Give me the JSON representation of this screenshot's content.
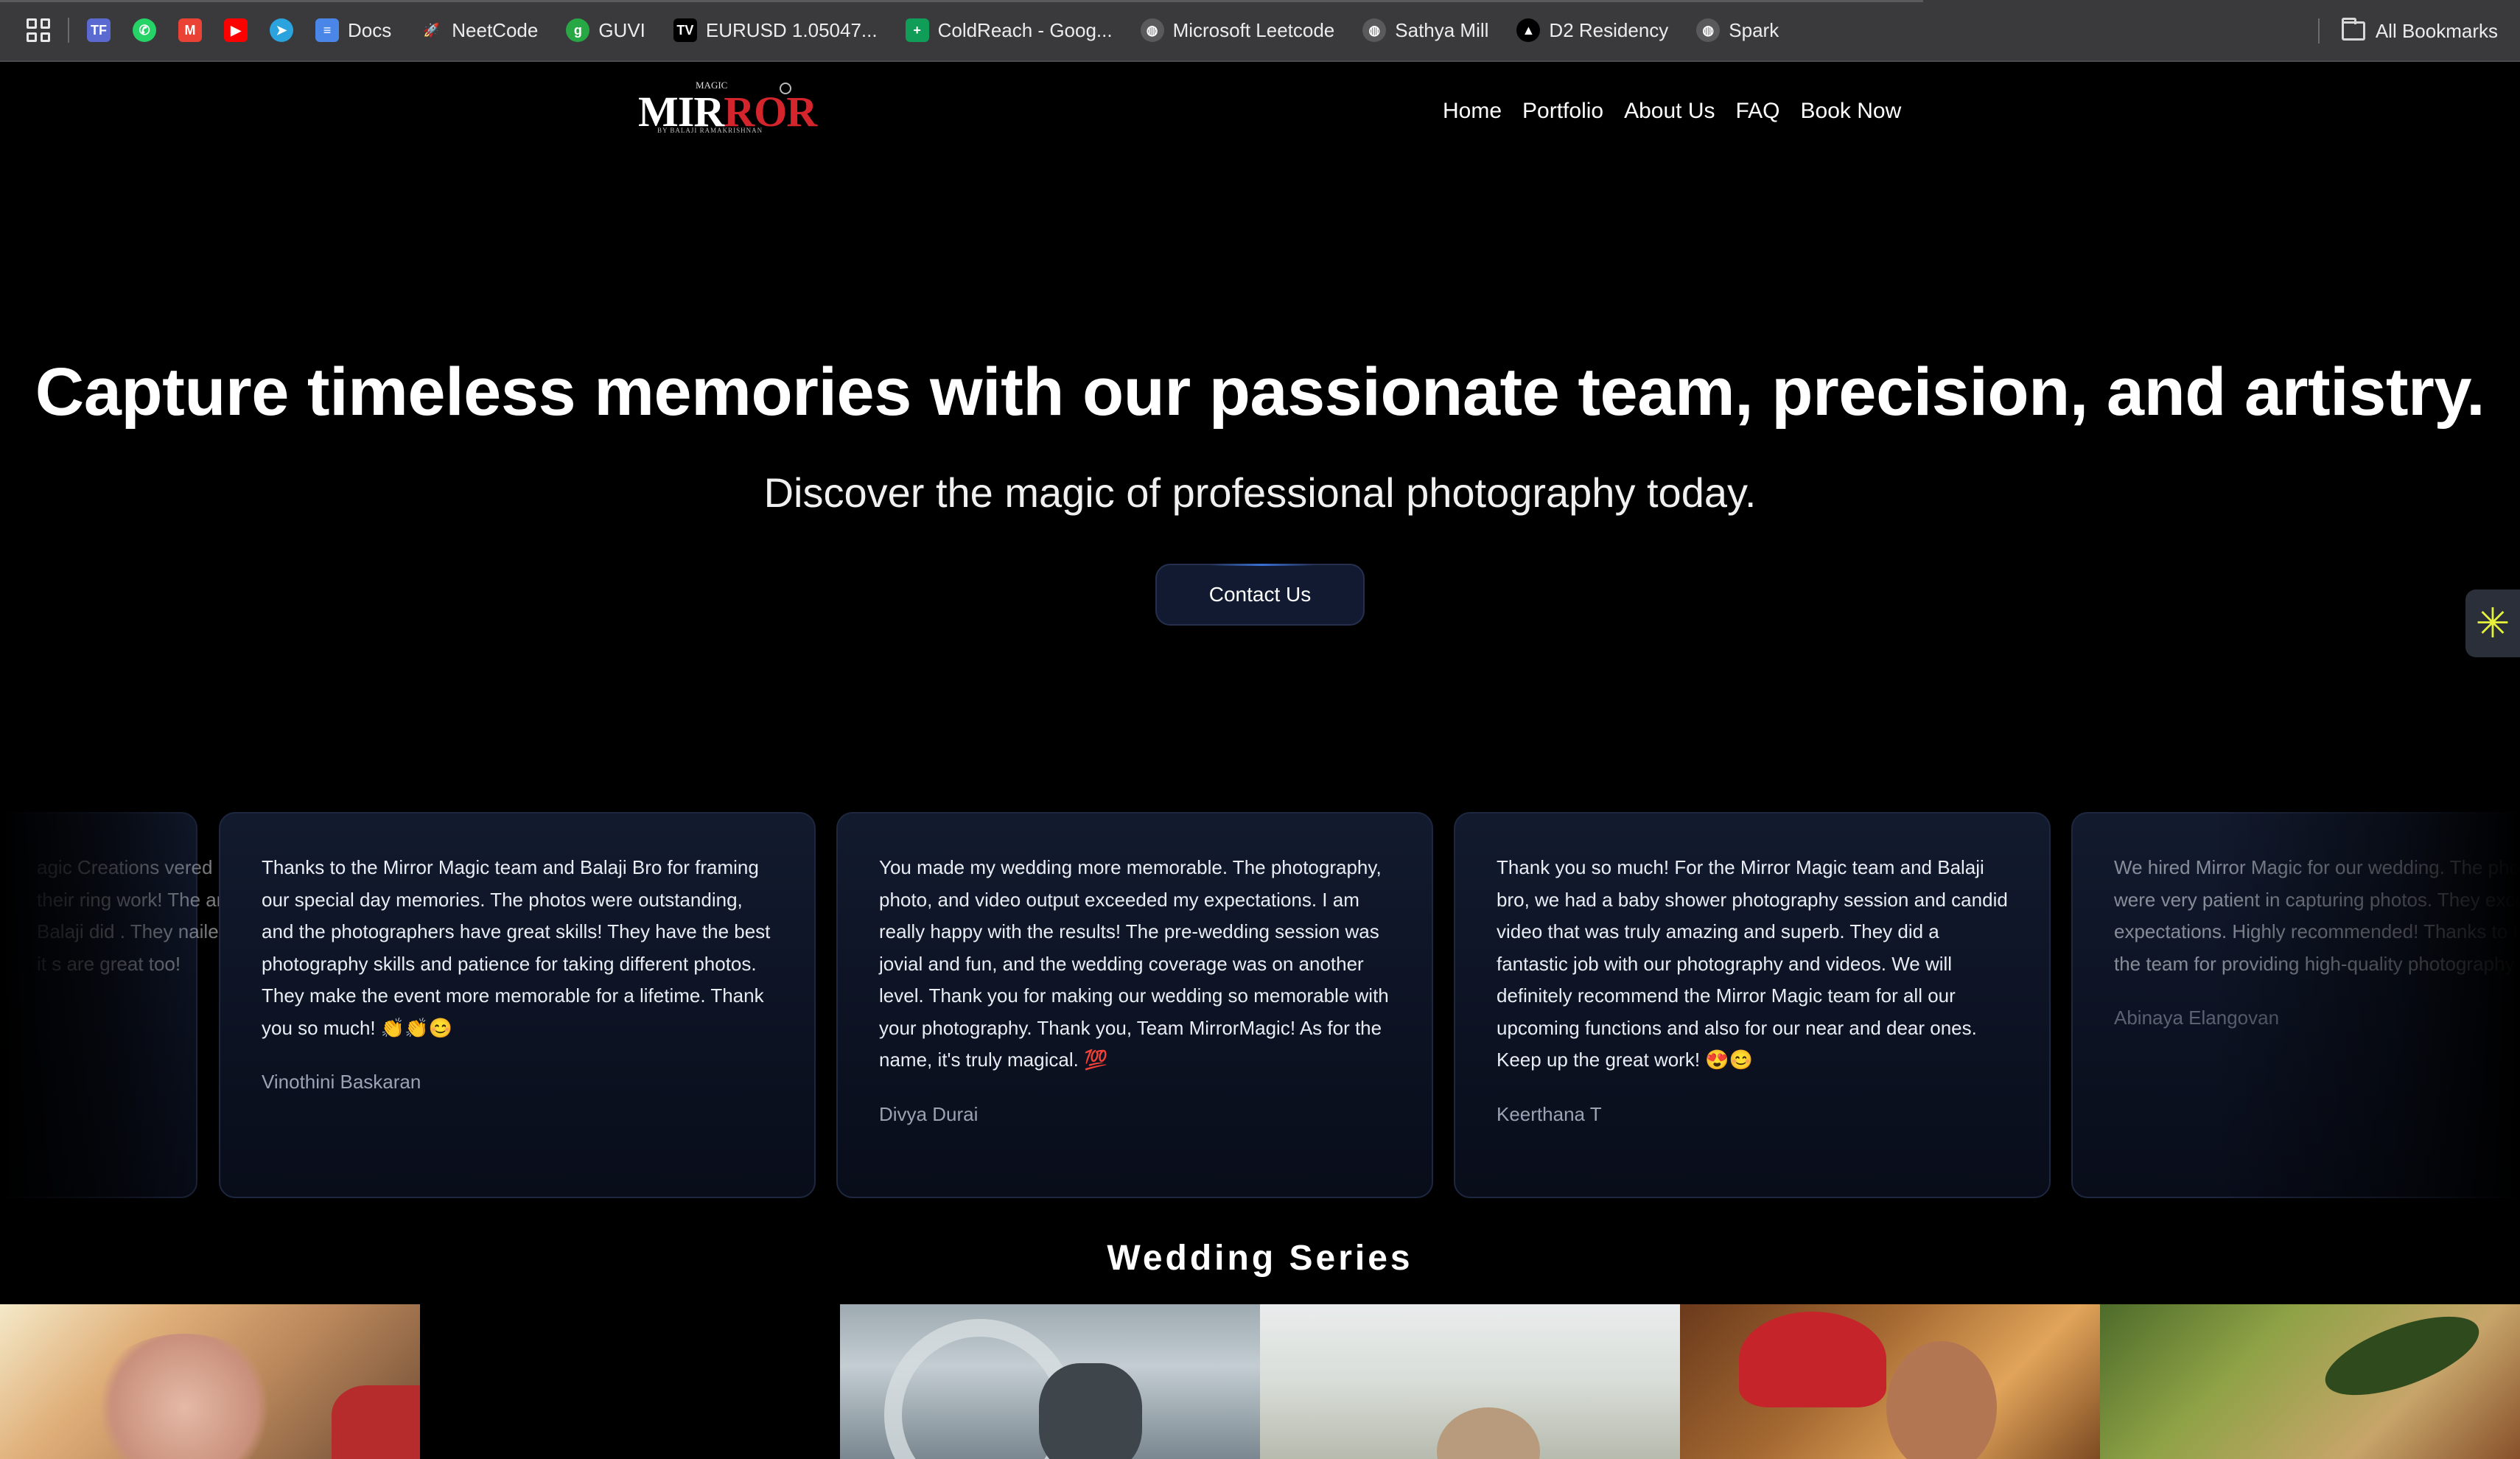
{
  "bookmarks": {
    "items": [
      {
        "label": "",
        "icon": "teachable-icon",
        "color": "#5b6ad0",
        "glyph": "TF"
      },
      {
        "label": "",
        "icon": "whatsapp-icon",
        "color": "#25d366",
        "glyph": "✆"
      },
      {
        "label": "",
        "icon": "gmail-icon",
        "color": "#ea4335",
        "glyph": "M"
      },
      {
        "label": "",
        "icon": "youtube-icon",
        "color": "#ff0000",
        "glyph": "▶"
      },
      {
        "label": "",
        "icon": "telegram-icon",
        "color": "#2aa3df",
        "glyph": "➤"
      },
      {
        "label": "Docs",
        "icon": "docs-icon",
        "color": "#4a86e8",
        "glyph": "≡"
      },
      {
        "label": "NeetCode",
        "icon": "rocket-icon",
        "color": "#3a3a3c",
        "glyph": "🚀"
      },
      {
        "label": "GUVI",
        "icon": "guvi-icon",
        "color": "#28a745",
        "glyph": "g"
      },
      {
        "label": "EURUSD 1.05047...",
        "icon": "tradingview-icon",
        "color": "#000000",
        "glyph": "TV"
      },
      {
        "label": "ColdReach - Goog...",
        "icon": "sheets-icon",
        "color": "#0f9d58",
        "glyph": "+"
      },
      {
        "label": "Microsoft Leetcode",
        "icon": "globe-icon",
        "color": "#5a5a5c",
        "glyph": "◍"
      },
      {
        "label": "Sathya Mill",
        "icon": "globe-icon",
        "color": "#5a5a5c",
        "glyph": "◍"
      },
      {
        "label": "D2 Residency",
        "icon": "d2-icon",
        "color": "#000000",
        "glyph": "▲"
      },
      {
        "label": "Spark",
        "icon": "globe-icon",
        "color": "#5a5a5c",
        "glyph": "◍"
      }
    ],
    "all_bookmarks": "All Bookmarks"
  },
  "header": {
    "logo": {
      "magic": "MAGIC",
      "word_part1": "MI",
      "word_part2": "R",
      "word_part3": "ROR",
      "by": "BY BALAJI RAMAKRISHNAN"
    },
    "nav": [
      "Home",
      "Portfolio",
      "About Us",
      "FAQ",
      "Book Now"
    ]
  },
  "hero": {
    "title": "Capture timeless memories with our passionate team, precision, and artistry.",
    "subtitle": "Discover the magic of professional photography today.",
    "cta": "Contact Us"
  },
  "testimonials": [
    {
      "text": "agic Creations vered their ring work! The and Balaji did . They nailed it s are great too!",
      "author": ""
    },
    {
      "text": "Thanks to the Mirror Magic team and Balaji Bro for framing our special day memories. The photos were outstanding, and the photographers have great skills! They have the best photography skills and patience for taking different photos. They make the event more memorable for a lifetime. Thank you so much! 👏👏😊",
      "author": "Vinothini Baskaran"
    },
    {
      "text": "You made my wedding more memorable. The photography, photo, and video output exceeded my expectations. I am really happy with the results! The pre-wedding session was jovial and fun, and the wedding coverage was on another level. Thank you for making our wedding so memorable with your photography. Thank you, Team MirrorMagic! As for the name, it's truly magical. 💯",
      "author": "Divya Durai"
    },
    {
      "text": "Thank you so much! For the Mirror Magic team and Balaji bro, we had a baby shower photography session and candid video that was truly amazing and superb. They did a fantastic job with our photography and videos. We will definitely recommend the Mirror Magic team for all our upcoming functions and also for our near and dear ones. Keep up the great work! 😍😊",
      "author": "Keerthana T"
    },
    {
      "text": "We hired Mirror Magic for our wedding. The photographers were very patient in capturing photos. They exceeded our expectations. Highly recommended! Thanks to Balaji and the team for providing high-quality photography at an aff",
      "author": "Abinaya Elangovan"
    }
  ],
  "wedding_series": {
    "title": "Wedding Series"
  },
  "colors": {
    "background": "#000000",
    "card": "#0f1628",
    "accent_red": "#d4252c",
    "widget_star": "#e7f23b"
  }
}
